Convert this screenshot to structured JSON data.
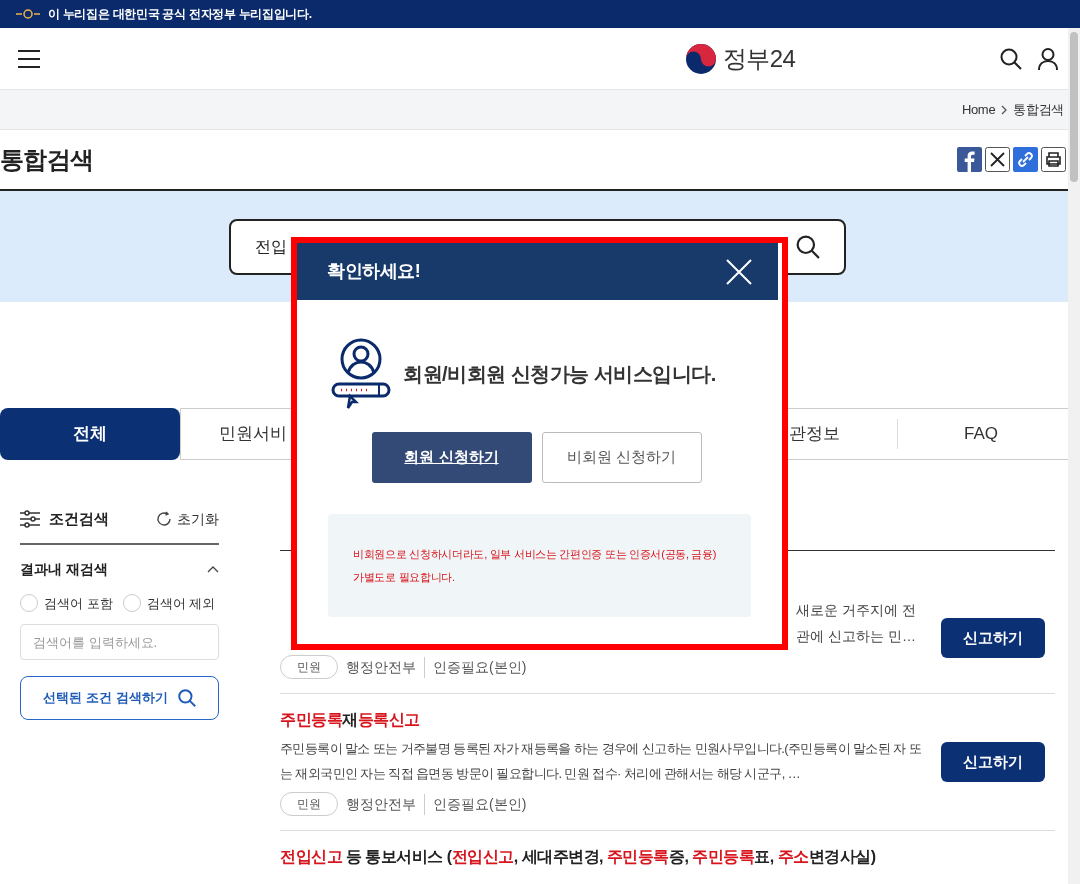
{
  "gov_banner": {
    "text": "이 누리집은 대한민국 공식 전자정부 누리집입니다."
  },
  "header": {
    "logo_text": "정부24"
  },
  "breadcrumb": [
    "Home",
    "통합검색"
  ],
  "page_title": "통합검색",
  "search": {
    "value": "전입"
  },
  "tabs": [
    {
      "label": "전체",
      "selected": true
    },
    {
      "label": "민원서비",
      "selected": false
    },
    {
      "label": "관정보",
      "selected": false
    },
    {
      "label": "FAQ",
      "selected": false
    }
  ],
  "filter": {
    "title": "조건검색",
    "reset": "초기화",
    "section": "결과내 재검색",
    "expanded": true,
    "options": [
      {
        "label": "검색어 포함",
        "checked": false
      },
      {
        "label": "검색어 제외",
        "checked": false
      }
    ],
    "placeholder": "검색어를 입력하세요.",
    "submit": "선택된 조건 검색하기"
  },
  "results": [
    {
      "description": [
        "새로운 거주지에 전",
        "관에 신고하는 민…"
      ],
      "type": "민원",
      "agency": "행정안전부",
      "auth": "인증필요(본인)",
      "action": "신고하기"
    },
    {
      "title": [
        {
          "text": "주민등록",
          "highlight": true
        },
        {
          "text": "재",
          "highlight": false
        },
        {
          "text": "등록신고",
          "highlight": true
        }
      ],
      "description": [
        "주민등록이 말소 또는 거주불명 등록된 자가 재등록을 하는 경우에 신고하는 민원사무입니다.(주민등록이 말소된 자 또는 재외국민인 자는 직접 읍면동 방문이 필요합니다. 민원 접수· 처리에 관해서는 해당 시군구, …"
      ],
      "type": "민원",
      "agency": "행정안전부",
      "auth": "인증필요(본인)",
      "action": "신고하기"
    },
    {
      "title": [
        {
          "text": "전입신고",
          "highlight": true
        },
        {
          "text": " 등 통보서비스 (",
          "highlight": false
        },
        {
          "text": "전입신고",
          "highlight": true
        },
        {
          "text": ", 세대주변경, ",
          "highlight": false
        },
        {
          "text": "주민등록",
          "highlight": true
        },
        {
          "text": "증, ",
          "highlight": false
        },
        {
          "text": "주민등록",
          "highlight": true
        },
        {
          "text": "표, ",
          "highlight": false
        },
        {
          "text": "주소",
          "highlight": true
        },
        {
          "text": "변경사실)",
          "highlight": false
        }
      ]
    }
  ],
  "modal": {
    "title": "확인하세요!",
    "message": "회원/비회원 신청가능 서비스입니다.",
    "buttons": [
      {
        "label": "회원 신청하기",
        "primary": true
      },
      {
        "label": "비회원 신청하기",
        "primary": false
      }
    ],
    "notice": "비회원으로 신청하시더라도, 일부 서비스는 간편인증 또는 인증서(공동, 금융) 가별도로 필요합니다."
  }
}
